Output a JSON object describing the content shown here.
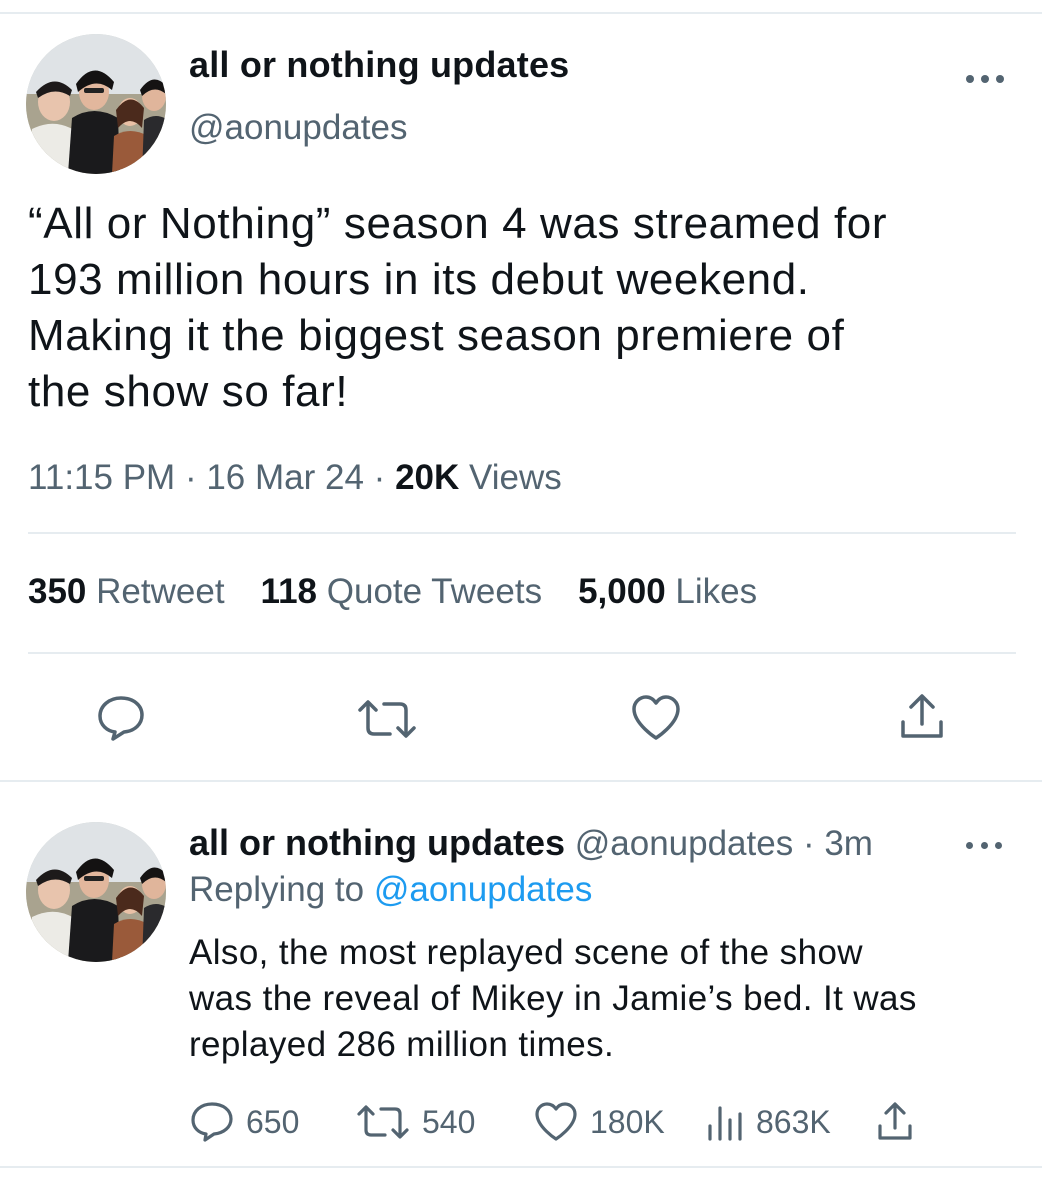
{
  "tweet": {
    "display_name": "all or nothing updates",
    "handle": "@aonupdates",
    "text": "“All or Nothing” season 4 was streamed for\n193 million hours in its debut weekend.\nMaking it the biggest season premiere of\nthe show so far!",
    "time": "11:15 PM",
    "date": "16 Mar 24",
    "separator": "·",
    "views_count": "20K",
    "views_label": "Views",
    "stats": {
      "retweets_count": "350",
      "retweets_label": "Retweet",
      "quotes_count": "118",
      "quotes_label": "Quote Tweets",
      "likes_count": "5,000",
      "likes_label": "Likes"
    }
  },
  "reply": {
    "display_name": "all or nothing updates",
    "handle": "@aonupdates",
    "separator": "·",
    "age": "3m",
    "replying_prefix": "Replying to",
    "replying_to": "@aonupdates",
    "text": "Also, the most replayed scene of the show\nwas the reveal of Mikey in Jamie’s bed. It was\nreplayed 286 million times.",
    "actions": {
      "replies": "650",
      "retweets": "540",
      "likes": "180K",
      "views": "863K"
    }
  },
  "icons": {
    "more": "more-icon",
    "reply": "reply-icon",
    "retweet": "retweet-icon",
    "like": "heart-icon",
    "share": "share-icon",
    "views": "analytics-icon"
  },
  "colors": {
    "text": "#0f1419",
    "secondary": "#536471",
    "link": "#1d9bf0",
    "divider": "#e6ecf0"
  }
}
